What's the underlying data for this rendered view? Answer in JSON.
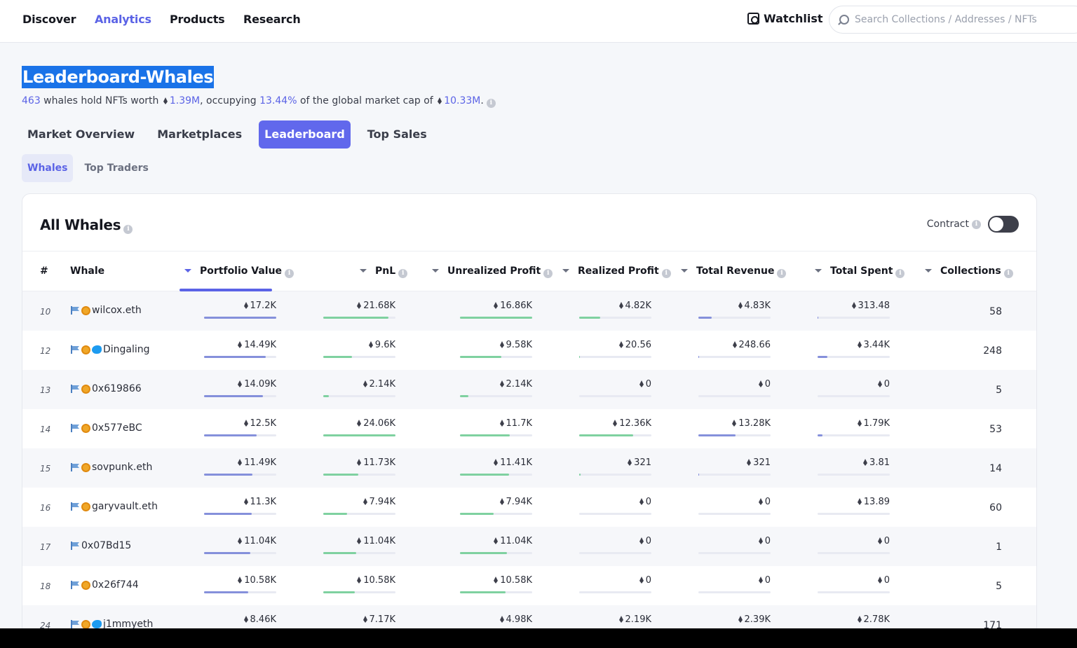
{
  "nav": {
    "links": [
      "Discover",
      "Analytics",
      "Products",
      "Research"
    ],
    "active": "Analytics",
    "watchlist": "Watchlist",
    "search_placeholder": "Search Collections / Addresses / NFTs"
  },
  "header": {
    "title": "Leaderboard-Whales",
    "summary": {
      "count": "463",
      "t1": " whales hold NFTs worth ",
      "worth": "1.39M",
      "t2": ", occupying ",
      "pct": "13.44%",
      "t3": " of the global market cap of ",
      "cap": "10.33M",
      "t4": "."
    }
  },
  "tabs": [
    "Market Overview",
    "Marketplaces",
    "Leaderboard",
    "Top Sales"
  ],
  "active_tab": "Leaderboard",
  "subtabs": [
    "Whales",
    "Top Traders"
  ],
  "active_subtab": "Whales",
  "card": {
    "title": "All Whales",
    "contract_label": "Contract",
    "contract_on": false
  },
  "columns": {
    "rank": "#",
    "whale": "Whale",
    "portfolio": "Portfolio Value",
    "pnl": "PnL",
    "unrealized": "Unrealized Profit",
    "realized": "Realized Profit",
    "revenue": "Total Revenue",
    "spent": "Total Spent",
    "collections": "Collections"
  },
  "sorted_by": "Portfolio Value",
  "colors": {
    "accent": "#5b63e6",
    "bar_blue": "#8590db",
    "bar_green": "#7fd1a0"
  },
  "rows": [
    {
      "rank": "10",
      "name": "wilcox.eth",
      "badges": [
        "flag",
        "coin"
      ],
      "portfolio": "17.2K",
      "pnl": "21.68K",
      "unrealized": "16.86K",
      "realized": "4.82K",
      "revenue": "4.83K",
      "spent": "313.48",
      "collections": "58",
      "fills": {
        "portfolio": 1.0,
        "pnl": 0.9,
        "unrealized": 1.0,
        "realized": 0.29,
        "revenue": 0.18,
        "spent": 0.01
      }
    },
    {
      "rank": "12",
      "name": "Dingaling",
      "badges": [
        "flag",
        "coin",
        "twitter"
      ],
      "portfolio": "14.49K",
      "pnl": "9.6K",
      "unrealized": "9.58K",
      "realized": "20.56",
      "revenue": "248.66",
      "spent": "3.44K",
      "collections": "248",
      "fills": {
        "portfolio": 0.85,
        "pnl": 0.4,
        "unrealized": 0.57,
        "realized": 0.01,
        "revenue": 0.01,
        "spent": 0.14
      }
    },
    {
      "rank": "13",
      "name": "0x619866",
      "badges": [
        "flag",
        "coin"
      ],
      "portfolio": "14.09K",
      "pnl": "2.14K",
      "unrealized": "2.14K",
      "realized": "0",
      "revenue": "0",
      "spent": "0",
      "collections": "5",
      "fills": {
        "portfolio": 0.82,
        "pnl": 0.08,
        "unrealized": 0.12,
        "realized": 0,
        "revenue": 0,
        "spent": 0
      }
    },
    {
      "rank": "14",
      "name": "0x577eBC",
      "badges": [
        "flag",
        "coin"
      ],
      "portfolio": "12.5K",
      "pnl": "24.06K",
      "unrealized": "11.7K",
      "realized": "12.36K",
      "revenue": "13.28K",
      "spent": "1.79K",
      "collections": "53",
      "fills": {
        "portfolio": 0.73,
        "pnl": 1.0,
        "unrealized": 0.69,
        "realized": 0.75,
        "revenue": 0.51,
        "spent": 0.07
      }
    },
    {
      "rank": "15",
      "name": "sovpunk.eth",
      "badges": [
        "flag",
        "coin"
      ],
      "portfolio": "11.49K",
      "pnl": "11.73K",
      "unrealized": "11.41K",
      "realized": "321",
      "revenue": "321",
      "spent": "3.81",
      "collections": "14",
      "fills": {
        "portfolio": 0.67,
        "pnl": 0.49,
        "unrealized": 0.68,
        "realized": 0.02,
        "revenue": 0.01,
        "spent": 0.0
      }
    },
    {
      "rank": "16",
      "name": "garyvault.eth",
      "badges": [
        "flag",
        "coin"
      ],
      "portfolio": "11.3K",
      "pnl": "7.94K",
      "unrealized": "7.94K",
      "realized": "0",
      "revenue": "0",
      "spent": "13.89",
      "collections": "60",
      "fills": {
        "portfolio": 0.66,
        "pnl": 0.33,
        "unrealized": 0.47,
        "realized": 0,
        "revenue": 0,
        "spent": 0.0
      }
    },
    {
      "rank": "17",
      "name": "0x07Bd15",
      "badges": [
        "flag"
      ],
      "portfolio": "11.04K",
      "pnl": "11.04K",
      "unrealized": "11.04K",
      "realized": "0",
      "revenue": "0",
      "spent": "0",
      "collections": "1",
      "fills": {
        "portfolio": 0.64,
        "pnl": 0.46,
        "unrealized": 0.65,
        "realized": 0,
        "revenue": 0,
        "spent": 0
      }
    },
    {
      "rank": "18",
      "name": "0x26f744",
      "badges": [
        "flag",
        "coin"
      ],
      "portfolio": "10.58K",
      "pnl": "10.58K",
      "unrealized": "10.58K",
      "realized": "0",
      "revenue": "0",
      "spent": "0",
      "collections": "5",
      "fills": {
        "portfolio": 0.61,
        "pnl": 0.44,
        "unrealized": 0.63,
        "realized": 0,
        "revenue": 0,
        "spent": 0
      }
    },
    {
      "rank": "24",
      "name": "j1mmyeth",
      "badges": [
        "flag",
        "coin",
        "twitter"
      ],
      "portfolio": "8.46K",
      "pnl": "7.17K",
      "unrealized": "4.98K",
      "realized": "2.19K",
      "revenue": "2.39K",
      "spent": "2.78K",
      "collections": "171",
      "fills": {
        "portfolio": 0.49,
        "pnl": 0.3,
        "unrealized": 0.3,
        "realized": 0.13,
        "revenue": 0.09,
        "spent": 0.11
      }
    }
  ]
}
